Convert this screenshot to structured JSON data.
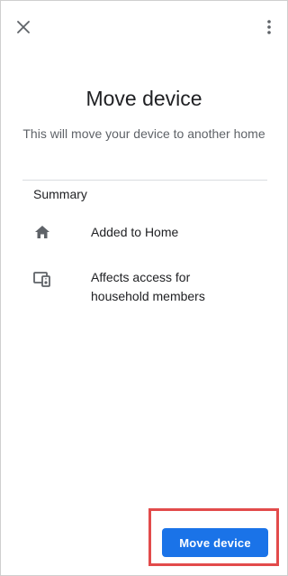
{
  "header": {
    "close_icon": "close-icon",
    "more_icon": "more-vert-icon"
  },
  "main": {
    "title": "Move device",
    "subtitle": "This will move your device to another home"
  },
  "summary": {
    "heading": "Summary",
    "items": [
      {
        "icon": "home-icon",
        "label": "Added to Home"
      },
      {
        "icon": "device-access-icon",
        "label_line1": "Affects access for",
        "label_line2": "household members"
      }
    ]
  },
  "footer": {
    "primary_button": "Move device"
  },
  "colors": {
    "accent": "#1a73e8",
    "highlight": "#e24b4b",
    "icon": "#5f6368",
    "divider": "#dadce0"
  }
}
